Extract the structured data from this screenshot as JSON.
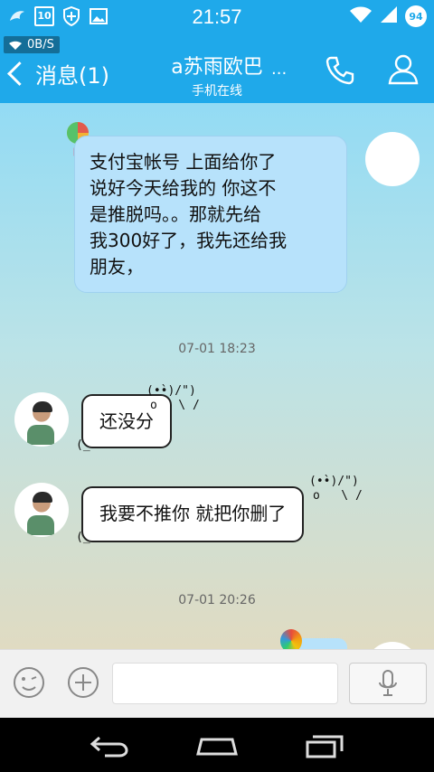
{
  "status_bar": {
    "time": "21:57",
    "calendar_day": "10",
    "battery": "94",
    "icons": [
      "dolphin-icon",
      "calendar-icon",
      "shield-icon",
      "image-icon",
      "wifi-icon",
      "signal-icon",
      "battery-icon"
    ]
  },
  "header": {
    "net_speed": "0B/S",
    "back_label": "消息(1)",
    "title": "a苏雨欧巴",
    "more": "...",
    "subtitle": "手机在线"
  },
  "chat": {
    "messages": [
      {
        "from": "self",
        "text": "支付宝帐号 上面给你了\n说好今天给我的 你这不\n是推脱吗。。那就先给\n我300好了，我先还给我\n朋友，"
      },
      {
        "time": "07-01 18:23"
      },
      {
        "from": "other",
        "text": "还没分",
        "kaomoji_top": "(•̀•)/\")",
        "kaomoji_mid": "o   \\ /",
        "kaomoji_bot": "(_"
      },
      {
        "from": "other",
        "text": "我要不推你  就把你删了",
        "kaomoji_top": "(•̀•)/\")",
        "kaomoji_mid": "o   \\ /",
        "kaomoji_bot": "(_"
      },
      {
        "time": "07-01 20:26"
      }
    ]
  },
  "colors": {
    "accent": "#1fa9ea",
    "sent_bubble": "#b7e2fb"
  }
}
